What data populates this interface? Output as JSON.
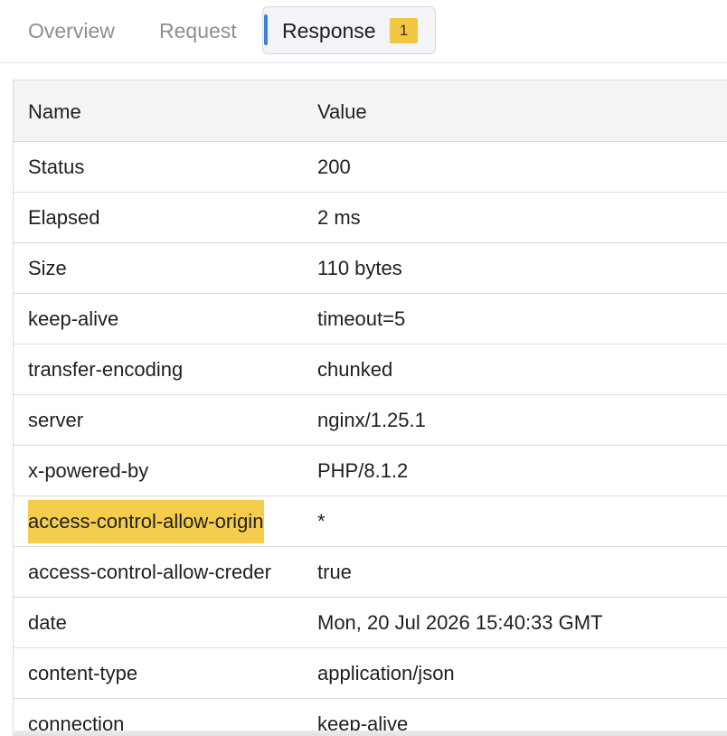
{
  "tabs": {
    "overview_label": "Overview",
    "request_label": "Request",
    "response_label": "Response",
    "response_badge": "1",
    "active_tab": "Response"
  },
  "table": {
    "headers": {
      "name": "Name",
      "value": "Value"
    },
    "rows": [
      {
        "name": "Status",
        "value": "200"
      },
      {
        "name": "Elapsed",
        "value": "2 ms"
      },
      {
        "name": "Size",
        "value": "110 bytes"
      },
      {
        "name": "keep-alive",
        "value": "timeout=5"
      },
      {
        "name": "transfer-encoding",
        "value": "chunked"
      },
      {
        "name": "server",
        "value": "nginx/1.25.1"
      },
      {
        "name": "x-powered-by",
        "value": "PHP/8.1.2"
      },
      {
        "name": "access-control-allow-origin",
        "value": "*",
        "highlighted": true
      },
      {
        "name": "access-control-allow-creder",
        "value": "true"
      },
      {
        "name": "date",
        "value": "Mon, 20 Jul 2026 15:40:33 GMT"
      },
      {
        "name": "content-type",
        "value": "application/json"
      },
      {
        "name": "connection",
        "value": "keep-alive"
      }
    ]
  },
  "colors": {
    "accent": "#3b82d6",
    "badge": "#f1c743",
    "highlight": "#f4cd4c"
  }
}
